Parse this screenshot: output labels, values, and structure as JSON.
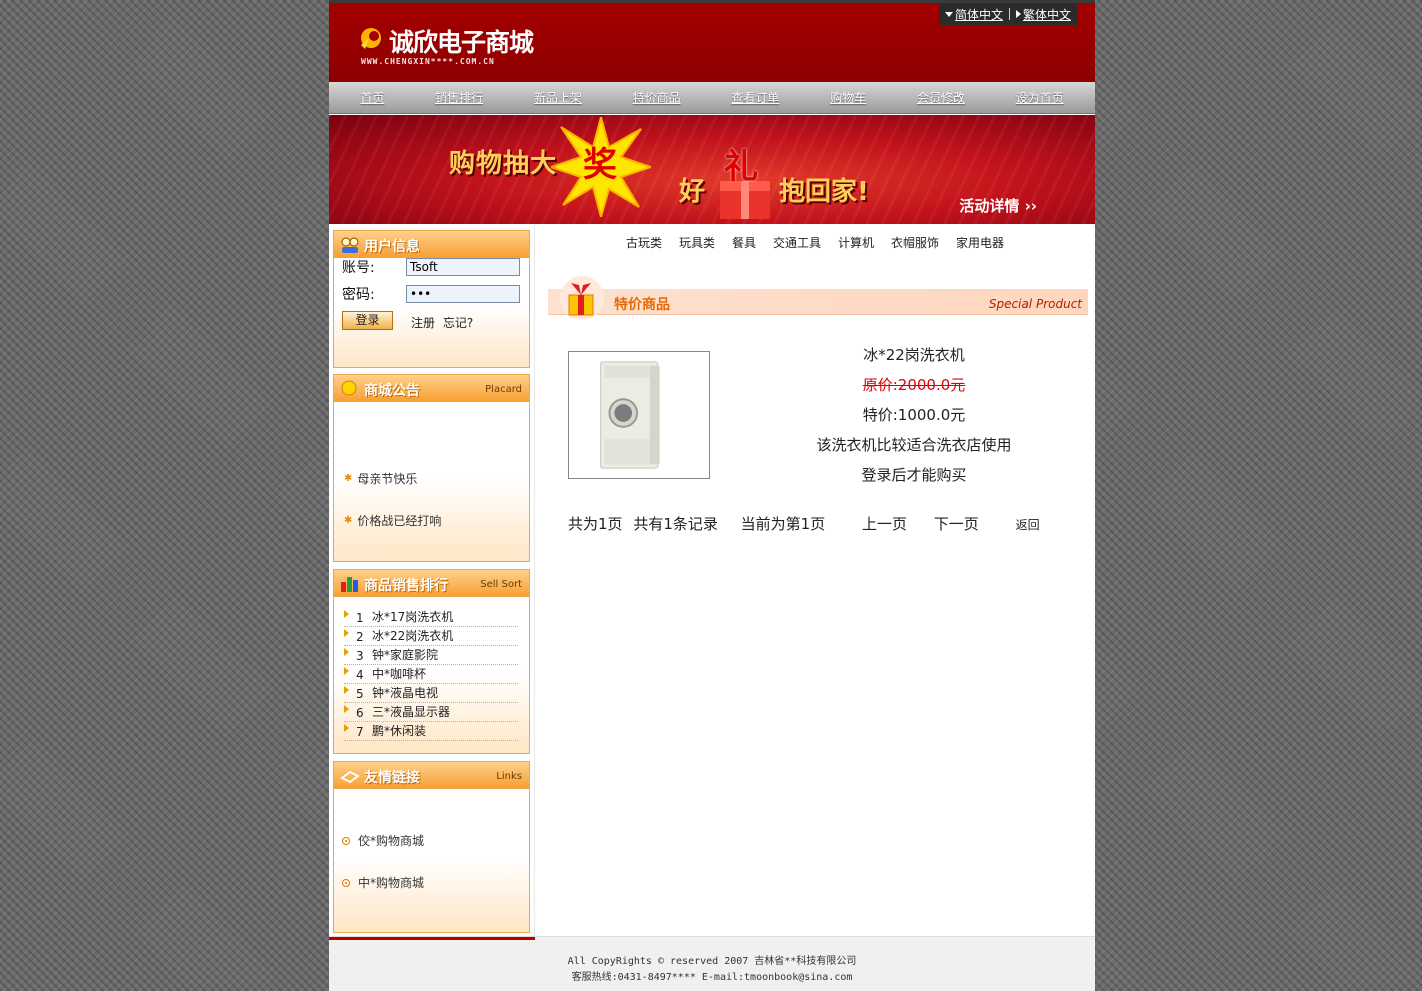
{
  "header": {
    "logo_text": "诚欣电子商城",
    "logo_url": "WWW.CHENGXIN****.COM.CN",
    "lang": {
      "simplified": "简体中文",
      "traditional": "繁体中文"
    }
  },
  "nav": {
    "items": [
      "首页",
      "销售排行",
      "新品上架",
      "特价商品",
      "查看订单",
      "购物车",
      "会员修改",
      "设为首页"
    ]
  },
  "banner": {
    "text_left": "购物抽大",
    "burst_char": "奖",
    "text_hao": "好",
    "gift_char": "礼",
    "text_home": "抱回家!",
    "detail": "活动详情 ››"
  },
  "user_box": {
    "title": "用户信息",
    "account_label": "账号:",
    "account_value": "Tsoft",
    "password_label": "密码:",
    "password_value": "•••",
    "login_button": "登录",
    "register_link": "注册",
    "forgot_link": "忘记?"
  },
  "notice_box": {
    "title": "商城公告",
    "subtitle": "Placard",
    "items": [
      "母亲节快乐",
      "价格战已经打响"
    ]
  },
  "rank_box": {
    "title": "商品销售排行",
    "subtitle": "Sell Sort",
    "items": [
      {
        "no": "1",
        "name": "冰*17岗洗衣机"
      },
      {
        "no": "2",
        "name": "冰*22岗洗衣机"
      },
      {
        "no": "3",
        "name": "钟*家庭影院"
      },
      {
        "no": "4",
        "name": "中*咖啡杯"
      },
      {
        "no": "5",
        "name": "钟*液晶电视"
      },
      {
        "no": "6",
        "name": "三*液晶显示器"
      },
      {
        "no": "7",
        "name": "鹏*休闲装"
      }
    ]
  },
  "links_box": {
    "title": "友情链接",
    "subtitle": "Links",
    "items": [
      "佼*购物商城",
      "中*购物商城"
    ]
  },
  "categories": [
    "古玩类",
    "玩具类",
    "餐具",
    "交通工具",
    "计算机",
    "衣帽服饰",
    "家用电器"
  ],
  "section": {
    "title": "特价商品",
    "subtitle": "Special Product"
  },
  "product": {
    "name": "冰*22岗洗衣机",
    "original_price": "原价:2000.0元",
    "special_price": "特价:1000.0元",
    "description": "该洗衣机比较适合洗衣店使用",
    "login_hint": "登录后才能购买"
  },
  "pager": {
    "total_pages": "共为1页",
    "total_records": "共有1条记录",
    "current": "当前为第1页",
    "prev": "上一页",
    "next": "下一页",
    "back": "返回"
  },
  "footer": {
    "line1": "All CopyRights © reserved 2007 吉林省**科技有限公司",
    "line2": "客服热线:0431-8497****  E-mail:tmoonbook@sina.com"
  },
  "colors": {
    "header_red": "#9a0000",
    "accent_orange": "#f6a035",
    "price_red": "#e00000"
  }
}
